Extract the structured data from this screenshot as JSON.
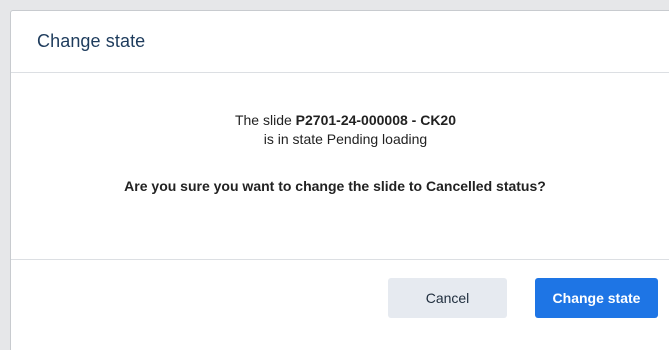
{
  "dialog": {
    "title": "Change state",
    "message": {
      "prefix": "The slide ",
      "slide_id": "P2701-24-000008 - CK20",
      "state_line": "is in state Pending loading",
      "question": "Are you sure you want to change the slide to Cancelled status?"
    },
    "buttons": {
      "cancel": "Cancel",
      "confirm": "Change state"
    }
  },
  "colors": {
    "title": "#1d3b5c",
    "cancel_bg": "#e6eaf0",
    "confirm_bg": "#1e75e5"
  }
}
